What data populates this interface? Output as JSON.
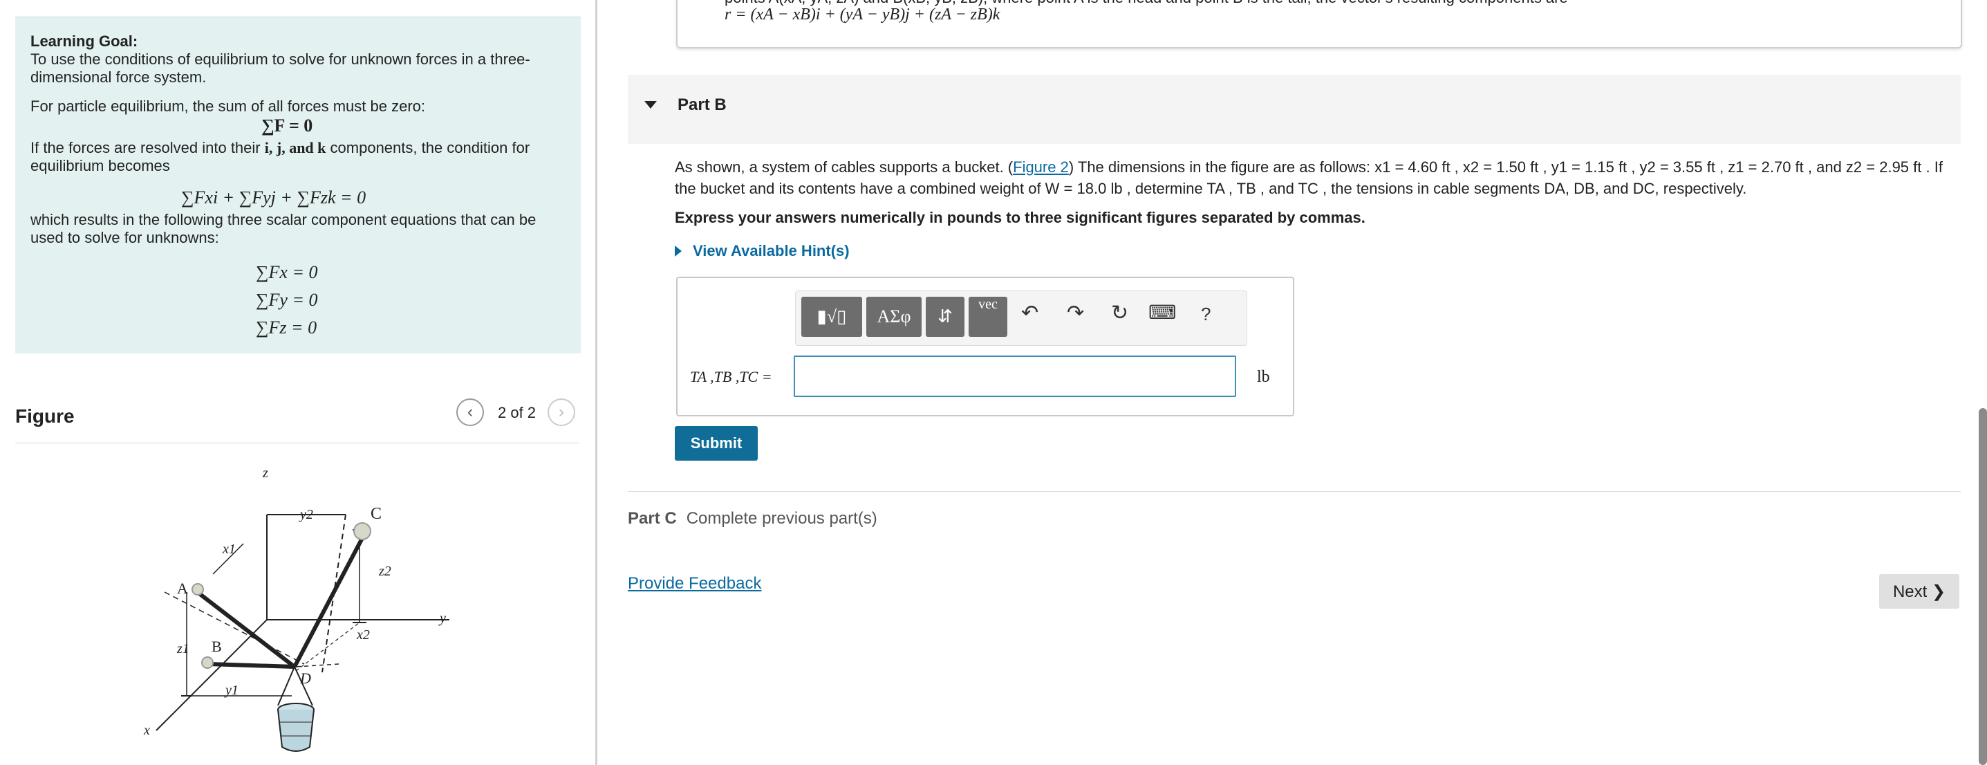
{
  "left": {
    "goal_title": "Learning Goal:",
    "goal_desc": "To use the conditions of equilibrium to solve for unknown forces in a three-dimensional force system.",
    "particle_text": "For particle equilibrium, the sum of all forces must be zero:",
    "eq_sum": "∑F = 0",
    "resolve_text_a": "If the forces are resolved into their",
    "resolve_text_b": "components, the condition for equilibrium becomes",
    "unit_vectors": "i, j, and k",
    "eq_vector": "∑Fxi + ∑Fyj + ∑Fzk = 0",
    "scalar_text": "which results in the following three scalar component equations that can be used to solve for unknowns:",
    "eq_fx": "∑Fx = 0",
    "eq_fy": "∑Fy = 0",
    "eq_fz": "∑Fz = 0",
    "figure_title": "Figure",
    "figure_count": "2 of 2",
    "fig_labels": {
      "z": "z",
      "y2": "y2",
      "C": "C",
      "x1": "x1",
      "A": "A",
      "z2": "z2",
      "y": "y",
      "x2": "x2",
      "z1": "z1",
      "B": "B",
      "D": "D",
      "y1": "y1",
      "x": "x"
    }
  },
  "right": {
    "hint_line1": "points A(xA, yA, zA) and B(xB, yB, zB), where point A is the head and point B is the tail, the vector's resulting components are",
    "hint_line2": "r = (xA − xB)i + (yA − yB)j + (zA − zB)k",
    "partb_title": "Part B",
    "problem_text_1": "As shown, a system of cables supports a bucket. (",
    "figure_link": "Figure 2",
    "problem_text_2": ") The dimensions in the figure are as follows: x1 = 4.60 ft , x2 = 1.50 ft , y1 = 1.15 ft , y2 = 3.55 ft , z1 = 2.70 ft , and z2 = 2.95 ft . If the bucket and its contents have a combined weight of W = 18.0 lb , determine TA , TB , and TC , the tensions in cable segments DA, DB, and DC, respectively.",
    "instruction": "Express your answers numerically in pounds to three significant figures separated by commas.",
    "hints_label": "View Available Hint(s)",
    "toolbar": {
      "templates": "▮√▯",
      "greek": "ΑΣφ",
      "arrows": "⇵",
      "vec": "vec",
      "undo_icon": "↶",
      "redo_icon": "↷",
      "reset_icon": "↻",
      "keyboard_icon": "⌨",
      "help": "?"
    },
    "answer_label": "TA ,TB ,TC =",
    "answer_value": "",
    "answer_unit": "lb",
    "submit_label": "Submit",
    "partc_title": "Part C",
    "partc_status": "Complete previous part(s)",
    "feedback_label": "Provide Feedback",
    "next_label": "Next ❯"
  }
}
